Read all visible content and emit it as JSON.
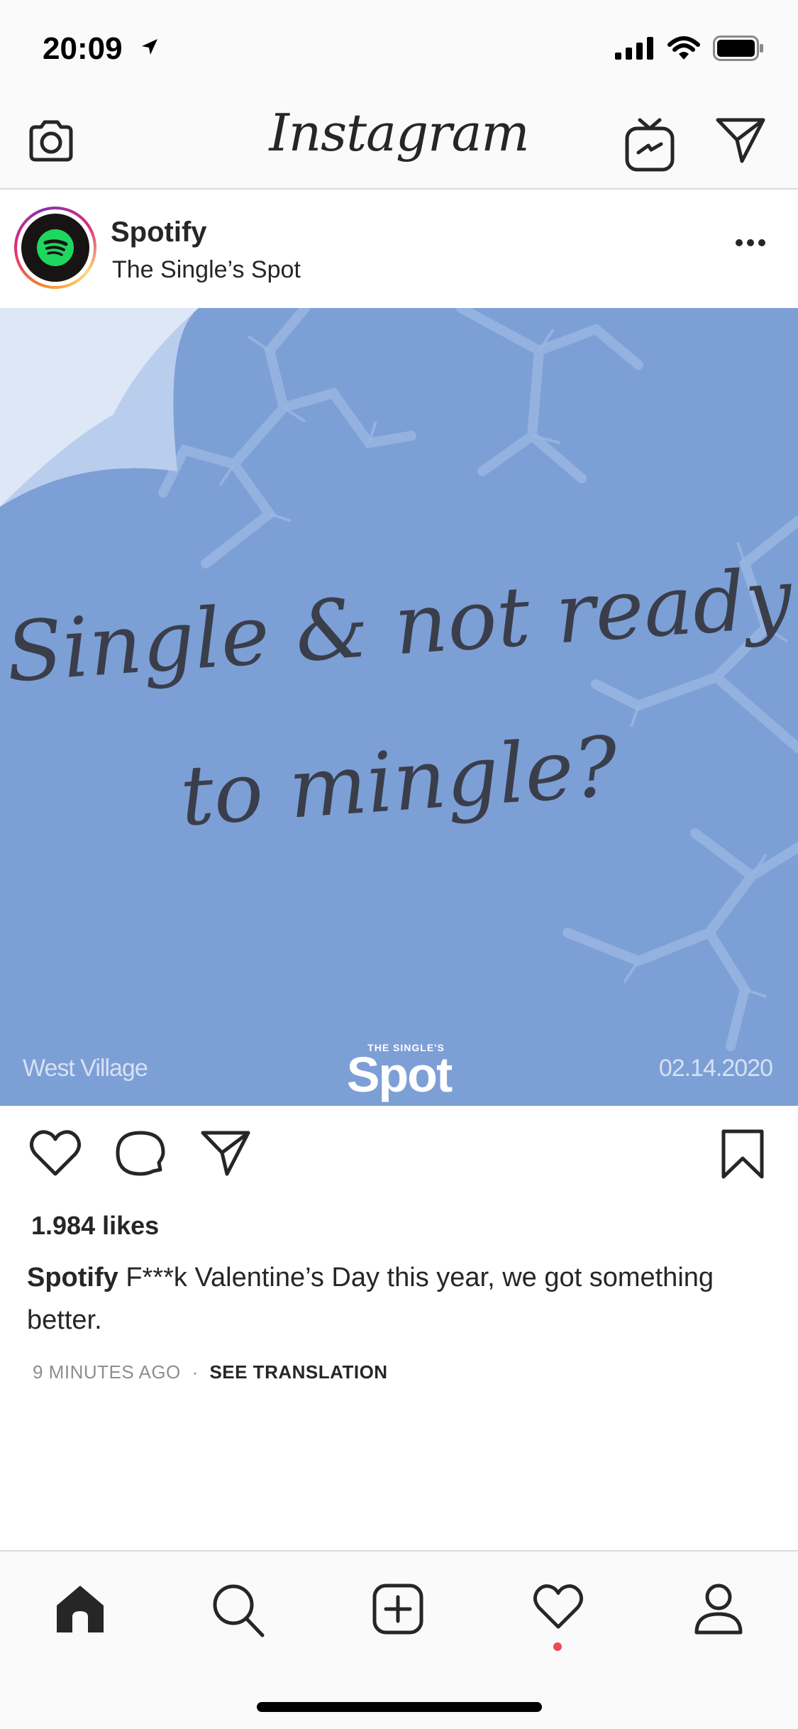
{
  "status_bar": {
    "time": "20:09"
  },
  "nav": {
    "logo": "Instagram"
  },
  "post": {
    "username": "Spotify",
    "location": "The Single’s Spot",
    "image": {
      "headline_line1": "Single & not ready",
      "headline_line2": "to mingle?",
      "brand_small": "THE SINGLE'S",
      "brand_big": "Spot",
      "location_text": "West Village",
      "date_text": "02.14.2020",
      "background_color": "#7c9fd6"
    },
    "likes": "1.984 likes",
    "caption_user": "Spotify",
    "caption_text": " F***k Valentine’s Day this year, we got something better.",
    "time_ago": "9 MINUTES AGO",
    "separator": "·",
    "see_translation": "SEE TRANSLATION"
  },
  "icons": {
    "camera": "camera-icon",
    "igtv": "igtv-icon",
    "direct": "paper-plane-icon",
    "more": "more-dots-icon",
    "like": "heart-icon",
    "comment": "comment-icon",
    "share": "paper-plane-icon",
    "save": "bookmark-icon",
    "home": "home-icon",
    "search": "search-icon",
    "new_post": "plus-square-icon",
    "activity": "heart-icon",
    "profile": "profile-icon"
  },
  "colors": {
    "accent_dot": "#ed4956",
    "spotify_green": "#1ed760"
  }
}
